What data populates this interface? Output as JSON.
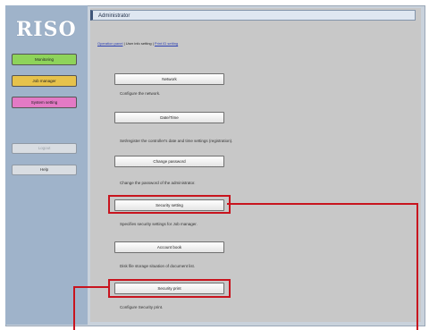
{
  "sidebar": {
    "logo": "RISO",
    "buttons": {
      "monitoring": "Monitoring",
      "job_manager": "Job manager",
      "system_setting": "System setting",
      "logout": "Logout",
      "help": "Help"
    }
  },
  "header": {
    "title": "Administrator"
  },
  "breadcrumb": {
    "link1": "Operation panel",
    "current": "User info setting",
    "link2": "Print ID setting"
  },
  "menu": [
    {
      "button": "Network",
      "desc": "Configure the network."
    },
    {
      "button": "Date/Time",
      "desc": "Set/register the controller's date and time settings (registration)."
    },
    {
      "button": "Change password",
      "desc": "Change the password of the administrator."
    },
    {
      "button": "Security setting",
      "desc": "Specifies security settings for Job manager."
    },
    {
      "button": "Account book",
      "desc": "Disk file storage situation of document list."
    },
    {
      "button": "Security print",
      "desc": "Configure Security print."
    }
  ],
  "colors": {
    "highlight": "#c8141e",
    "monitoring": "#8ed35a",
    "job_manager": "#e6c24b",
    "system_setting": "#e37ac5"
  }
}
